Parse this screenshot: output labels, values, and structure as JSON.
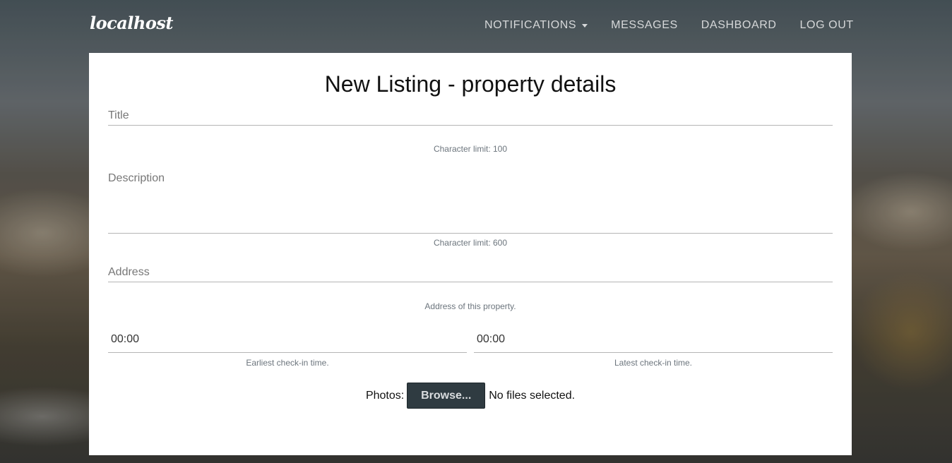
{
  "navbar": {
    "brand": "localhost",
    "items": [
      {
        "label": "NOTIFICATIONS",
        "dropdown": true
      },
      {
        "label": "MESSAGES"
      },
      {
        "label": "DASHBOARD"
      },
      {
        "label": "LOG OUT"
      }
    ]
  },
  "form": {
    "title": "New Listing - property details",
    "title_field": {
      "placeholder": "Title",
      "hint": "Character limit: 100"
    },
    "description_field": {
      "placeholder": "Description",
      "hint": "Character limit: 600"
    },
    "address_field": {
      "placeholder": "Address",
      "hint": "Address of this property."
    },
    "earliest_checkin": {
      "value": "00:00",
      "hint": "Earliest check-in time."
    },
    "latest_checkin": {
      "value": "00:00",
      "hint": "Latest check-in time."
    },
    "photos": {
      "label": "Photos:",
      "button": "Browse...",
      "status": "No files selected."
    }
  }
}
